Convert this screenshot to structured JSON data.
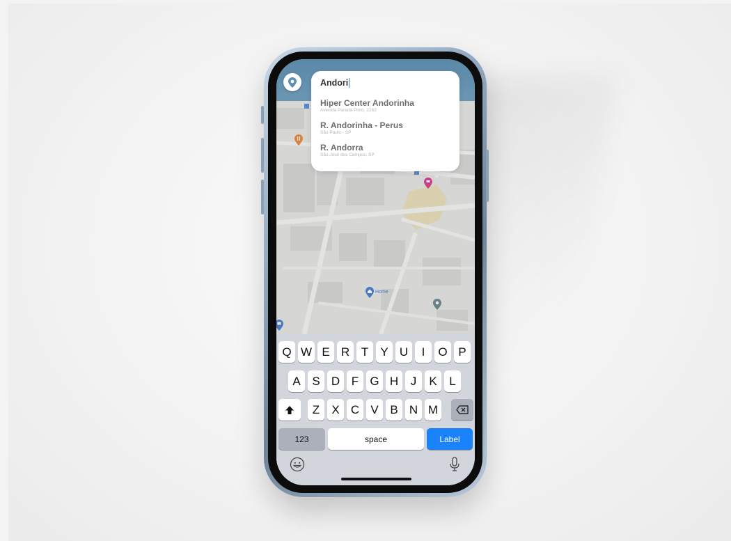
{
  "search": {
    "query": "Andori",
    "results": [
      {
        "title": "Hiper Center Andorinha",
        "subtitle": "Avenida Parada Pinto, 2262"
      },
      {
        "title": "R. Andorinha - Perus",
        "subtitle": "São Paulo - SP"
      },
      {
        "title": "R. Andorra",
        "subtitle": "São José dos Campos, SP"
      }
    ]
  },
  "map": {
    "home_label": "Home"
  },
  "keyboard": {
    "row1": [
      "Q",
      "W",
      "E",
      "R",
      "T",
      "Y",
      "U",
      "I",
      "O",
      "P"
    ],
    "row2": [
      "A",
      "S",
      "D",
      "F",
      "G",
      "H",
      "J",
      "K",
      "L"
    ],
    "row3": [
      "Z",
      "X",
      "C",
      "V",
      "B",
      "N",
      "M"
    ],
    "numbers_label": "123",
    "space_label": "space",
    "action_label": "Label"
  },
  "colors": {
    "accent": "#1a82fb",
    "header": "#6f9fbf",
    "keyboard_bg": "#d2d5db"
  }
}
